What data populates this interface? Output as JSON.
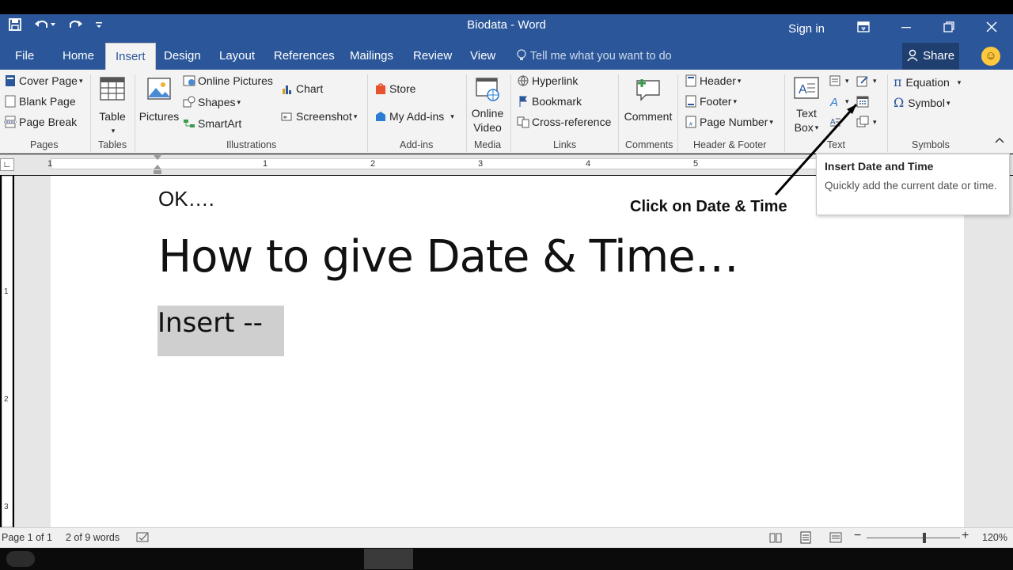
{
  "titlebar": {
    "title": "Biodata - Word",
    "sign_in": "Sign in",
    "qat": {
      "save_icon": "save-icon",
      "undo_icon": "undo-icon",
      "redo_icon": "redo-icon",
      "customize_icon": "customize-icon"
    }
  },
  "tabs": [
    "File",
    "Home",
    "Insert",
    "Design",
    "Layout",
    "References",
    "Mailings",
    "Review",
    "View"
  ],
  "active_tab": "Insert",
  "tell_me": "Tell me what you want to do",
  "share": "Share",
  "ribbon": {
    "pages": {
      "label": "Pages",
      "items": [
        "Cover Page",
        "Blank Page",
        "Page Break"
      ]
    },
    "tables": {
      "label": "Tables",
      "table": "Table"
    },
    "illustrations": {
      "label": "Illustrations",
      "pictures": "Pictures",
      "online_pictures": "Online Pictures",
      "shapes": "Shapes",
      "smartart": "SmartArt",
      "chart": "Chart",
      "screenshot": "Screenshot"
    },
    "addins": {
      "label": "Add-ins",
      "store": "Store",
      "my_addins": "My Add-ins"
    },
    "media": {
      "label": "Media",
      "online": "Online",
      "video": "Video"
    },
    "links": {
      "label": "Links",
      "hyperlink": "Hyperlink",
      "bookmark": "Bookmark",
      "cross_reference": "Cross-reference"
    },
    "comments": {
      "label": "Comments",
      "comment": "Comment"
    },
    "header_footer": {
      "label": "Header & Footer",
      "header": "Header",
      "footer": "Footer",
      "page_number": "Page Number"
    },
    "text": {
      "label": "Text",
      "text": "Text",
      "box": "Box"
    },
    "symbols": {
      "label": "Symbols",
      "equation": "Equation",
      "symbol": "Symbol"
    }
  },
  "tooltip": {
    "title": "Insert Date and Time",
    "description": "Quickly add the current date or time."
  },
  "ruler": {
    "h_numbers": [
      "1",
      "1",
      "2",
      "3",
      "4",
      "5"
    ],
    "v_numbers": [
      "1",
      "2",
      "3"
    ]
  },
  "document": {
    "line1": "OK….",
    "heading": "How to give Date & Time…",
    "selected_text": "Insert --",
    "annotation": "Click on Date & Time"
  },
  "status": {
    "page": "Page 1 of 1",
    "words": "2 of 9 words",
    "zoom": "120%",
    "zoom_level": 0.62
  },
  "colors": {
    "word_blue": "#2b579a",
    "ribbon_bg": "#f3f3f3",
    "selection": "#cfcfcf"
  }
}
